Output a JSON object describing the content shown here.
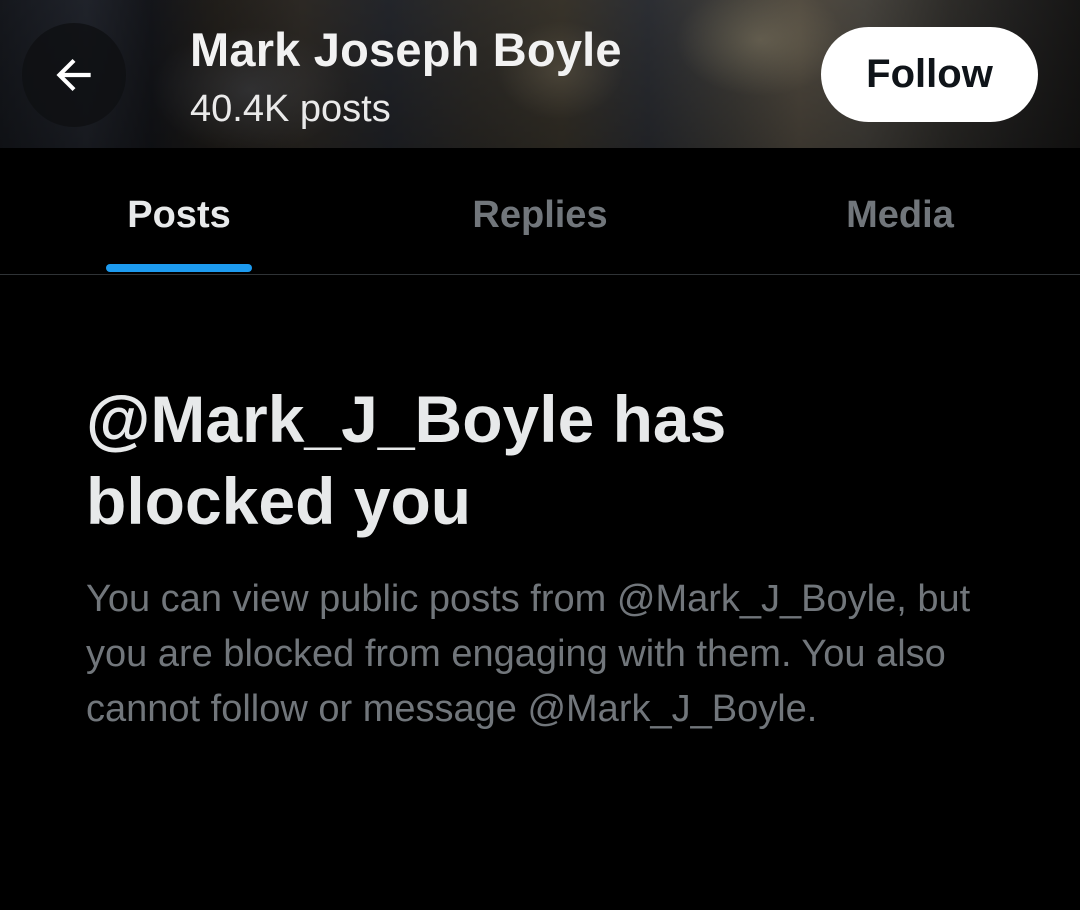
{
  "header": {
    "back_icon": "arrow-left-icon",
    "profile_name": "Mark Joseph Boyle",
    "post_count": "40.4K posts",
    "follow_label": "Follow"
  },
  "tabs": [
    {
      "label": "Posts",
      "active": true
    },
    {
      "label": "Replies",
      "active": false
    },
    {
      "label": "Media",
      "active": false
    }
  ],
  "message": {
    "title": "@Mark_J_Boyle has blocked you",
    "description": "You can view public posts from @Mark_J_Boyle, but you are blocked from engaging with them. You also cannot follow or message @Mark_J_Boyle."
  },
  "colors": {
    "background": "#000000",
    "accent": "#1d9bf0",
    "text_primary": "#e7e9ea",
    "text_secondary": "#71767b"
  }
}
